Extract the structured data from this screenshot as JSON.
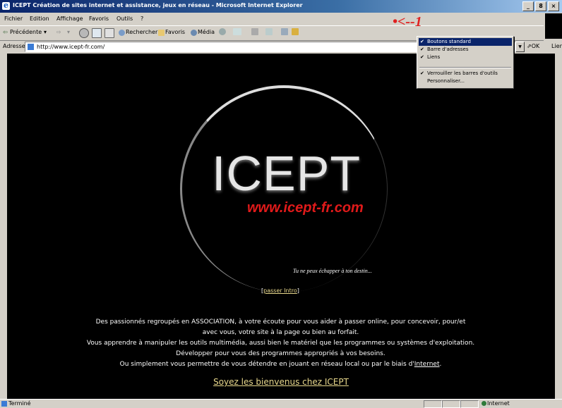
{
  "window": {
    "title": "ICEPT Création de sites internet et assistance, jeux en réseau - Microsoft Internet Explorer",
    "buttons": [
      "_",
      "8",
      "×"
    ]
  },
  "menubar": {
    "items": [
      "Fichier",
      "Edition",
      "Affichage",
      "Favoris",
      "Outils",
      "?"
    ]
  },
  "toolbar": {
    "back_label": "Précédente",
    "arrow_down": "▾",
    "forward_glyph": "⇨",
    "search_label": "Rechercher",
    "favorites_label": "Favoris",
    "media_label": "Média"
  },
  "address_bar": {
    "label": "Adresse",
    "url": "http://www.icept-fr.com/",
    "go_label": "OK",
    "links_label": "Lien"
  },
  "context_menu": {
    "items": [
      {
        "label": "Boutons standard",
        "checked": "✔"
      },
      {
        "label": "Barre d'adresses",
        "checked": "✔"
      },
      {
        "label": "Liens",
        "checked": "✔"
      },
      {
        "label": "Verrouiller les barres d'outils",
        "checked": "✔"
      },
      {
        "label": "Personnaliser...",
        "checked": ""
      }
    ]
  },
  "annotation": "•<--1",
  "page": {
    "logo": "ICEPT",
    "site_url": "www.icept-fr.com",
    "tagline": "Tu ne peux échapper à ton destin...",
    "skip_open": "[",
    "skip_link": "passer Intro",
    "skip_close": "]",
    "lines": [
      "Des passionnés regroupés en ASSOCIATION, à votre écoute pour vous aider à passer online, pour concevoir, pour/et",
      "avec vous, votre site à la page ou bien au forfait.",
      "Vous apprendre à manipuler les outils multimédia, aussi bien le matériel que les programmes ou systèmes d'exploitation.",
      "Développer pour vous des programmes appropriés à vos besoins."
    ],
    "last_line_prefix": "Ou simplement vous permettre de vous détendre en jouant en réseau local ou par le biais d'",
    "last_line_link": "Internet",
    "last_line_suffix": ".",
    "welcome": "Soyez les bienvenus chez ICEPT"
  },
  "status": {
    "text": "Terminé",
    "zone": "Internet"
  }
}
